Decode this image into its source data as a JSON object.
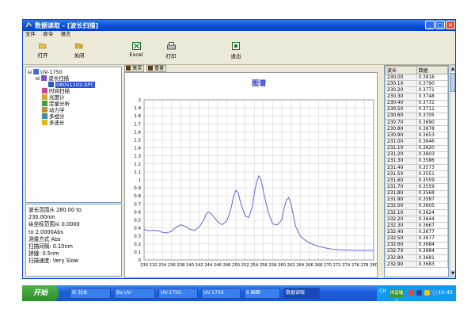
{
  "window": {
    "title": "数据读取 - [波长扫描]"
  },
  "menu": [
    "文件",
    "命令",
    "语言"
  ],
  "toolbar": [
    {
      "label": "打开",
      "icon": "open-folder-icon"
    },
    {
      "label": "关闭",
      "icon": "close-folder-icon"
    },
    {
      "label": "Excel",
      "icon": "excel-icon"
    },
    {
      "label": "打印",
      "icon": "printer-icon"
    },
    {
      "label": "退出",
      "icon": "exit-icon"
    }
  ],
  "tree": {
    "root": "UV-1750",
    "scan": "波长扫描",
    "file": "08051102.SPC",
    "items": [
      "时间扫描",
      "光度计",
      "定量分析",
      "动力学",
      "多组分",
      "多波长"
    ]
  },
  "info": [
    "波长范围从    280.00 to",
    "230.00nm",
    "纵坐标范围从    0.0000",
    "to 2.0000Abs",
    "测量方式  Abs",
    "扫描间隔: 0.10nm",
    "狭缝: 0.5nm",
    "扫描速度: Very Slow"
  ],
  "chart_tabs": [
    "激活",
    "重叠"
  ],
  "chart_data": {
    "type": "line",
    "title": "图谱",
    "xlim": [
      230,
      280
    ],
    "ylim": [
      0,
      2
    ],
    "grid": true,
    "xticks": [
      230,
      232,
      234,
      236,
      238,
      240,
      242,
      244,
      246,
      248,
      250,
      252,
      254,
      256,
      258,
      260,
      262,
      264,
      266,
      268,
      270,
      272,
      274,
      276,
      278,
      280
    ],
    "yticks": [
      "0",
      "0.1",
      "0.2",
      "0.3",
      "0.4",
      "0.5",
      "0.6",
      "0.7",
      "0.8",
      "0.9",
      "1",
      "1.1",
      "1.2",
      "1.3",
      "1.4",
      "1.5",
      "1.6",
      "1.7",
      "1.8",
      "1.9",
      "2"
    ],
    "series": [
      {
        "color": "#4a57d6",
        "x": [
          230,
          231,
          232,
          233,
          234,
          235,
          236,
          237,
          238,
          239,
          240,
          241,
          242,
          243,
          243.5,
          244,
          244.5,
          245,
          246,
          247,
          248,
          248.5,
          249,
          249.5,
          250,
          250.5,
          251,
          252,
          252.8,
          253.5,
          254,
          254.5,
          255,
          255.5,
          256,
          257,
          258,
          259,
          260,
          260.5,
          261,
          261.5,
          262,
          262.5,
          263,
          264,
          265,
          266,
          267,
          268,
          269,
          270,
          271,
          272,
          273,
          274,
          275,
          276,
          277,
          278,
          279,
          280
        ],
        "y": [
          0.38,
          0.365,
          0.37,
          0.365,
          0.345,
          0.338,
          0.36,
          0.41,
          0.44,
          0.42,
          0.38,
          0.37,
          0.41,
          0.5,
          0.57,
          0.6,
          0.58,
          0.55,
          0.48,
          0.44,
          0.49,
          0.56,
          0.66,
          0.8,
          0.87,
          0.84,
          0.72,
          0.55,
          0.53,
          0.65,
          0.83,
          0.97,
          1.05,
          1.0,
          0.85,
          0.6,
          0.45,
          0.44,
          0.5,
          0.65,
          0.75,
          0.78,
          0.7,
          0.56,
          0.42,
          0.3,
          0.25,
          0.215,
          0.19,
          0.17,
          0.155,
          0.145,
          0.135,
          0.13,
          0.127,
          0.125,
          0.122,
          0.12,
          0.12,
          0.12,
          0.12,
          0.12
        ]
      }
    ]
  },
  "table": {
    "headers": [
      "波长",
      "数据"
    ],
    "rows": [
      [
        "230.00",
        "0.3816"
      ],
      [
        "230.10",
        "0.3790"
      ],
      [
        "230.20",
        "0.3771"
      ],
      [
        "230.30",
        "0.3748"
      ],
      [
        "230.40",
        "0.3731"
      ],
      [
        "230.50",
        "0.3711"
      ],
      [
        "230.60",
        "0.3705"
      ],
      [
        "230.70",
        "0.3690"
      ],
      [
        "230.80",
        "0.3678"
      ],
      [
        "230.90",
        "0.3653"
      ],
      [
        "231.00",
        "0.3646"
      ],
      [
        "231.10",
        "0.3620"
      ],
      [
        "231.20",
        "0.3603"
      ],
      [
        "231.30",
        "0.3586"
      ],
      [
        "231.40",
        "0.3573"
      ],
      [
        "231.50",
        "0.3551"
      ],
      [
        "231.60",
        "0.3559"
      ],
      [
        "231.70",
        "0.3559"
      ],
      [
        "231.80",
        "0.3568"
      ],
      [
        "231.90",
        "0.3587"
      ],
      [
        "232.00",
        "0.3605"
      ],
      [
        "232.10",
        "0.3624"
      ],
      [
        "232.20",
        "0.3644"
      ],
      [
        "232.30",
        "0.3667"
      ],
      [
        "232.40",
        "0.3677"
      ],
      [
        "232.50",
        "0.3677"
      ],
      [
        "232.60",
        "0.3684"
      ],
      [
        "232.70",
        "0.3684"
      ],
      [
        "232.80",
        "0.3681"
      ],
      [
        "232.90",
        "0.3683"
      ]
    ]
  },
  "taskbar": {
    "start": "开始",
    "tasks": [
      "IE 封本",
      "Ba UV-",
      "UV-1750...",
      "UV-1750",
      "6 画图",
      "数据读取"
    ],
    "ime": "拼音输入",
    "tray_kbd": "CH",
    "clock": "10:45"
  }
}
